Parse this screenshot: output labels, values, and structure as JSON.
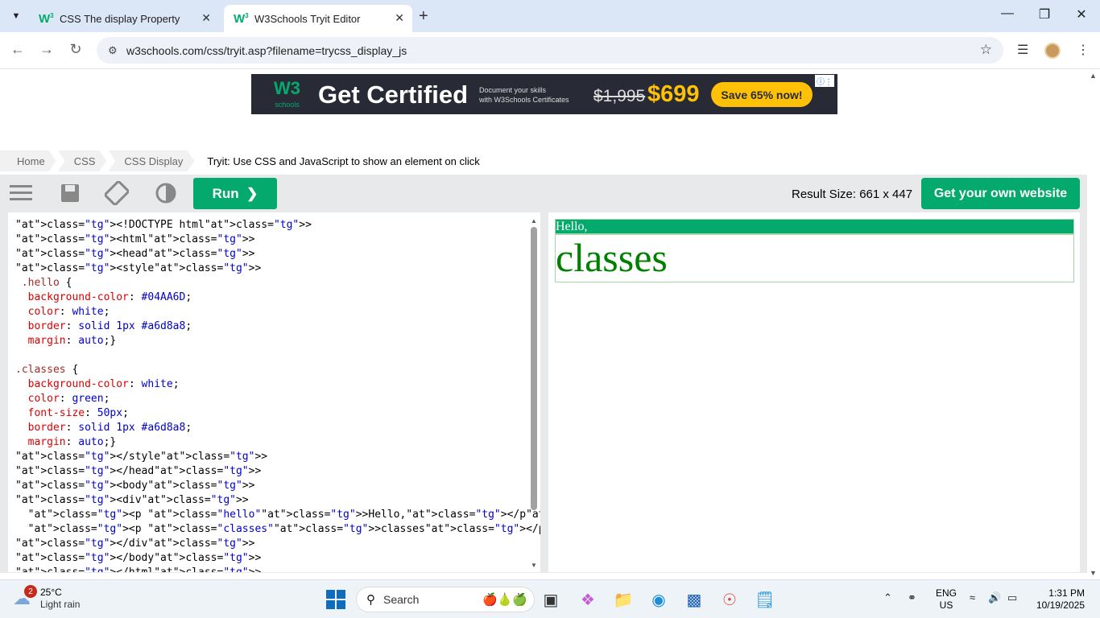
{
  "browser": {
    "tabs": [
      {
        "title": "CSS The display Property",
        "favicon": "W3"
      },
      {
        "title": "W3Schools Tryit Editor",
        "favicon": "W3"
      }
    ],
    "url": "w3schools.com/css/tryit.asp?filename=trycss_display_js"
  },
  "ad": {
    "brand_top": "W3",
    "brand_bottom": "schools",
    "headline": "Get Certified",
    "subtext_line1": "Document your skills",
    "subtext_line2": "with W3Schools Certificates",
    "old_price": "$1,995",
    "new_price": "$699",
    "cta": "Save 65% now!"
  },
  "breadcrumb": [
    "Home",
    "CSS",
    "CSS Display"
  ],
  "breadcrumb_current": "Tryit: Use CSS and JavaScript to show an element on click",
  "editor": {
    "run_label": "Run",
    "result_size": "Result Size: 661 x 447",
    "own_site_label": "Get your own website",
    "code_lines": [
      "<!DOCTYPE html>",
      "<html>",
      "<head>",
      "<style>",
      " .hello {",
      "  background-color: #04AA6D;",
      "  color: white;",
      "  border: solid 1px #a6d8a8;",
      "  margin: auto;}",
      "",
      ".classes {",
      "  background-color: white;",
      "  color: green;",
      "  font-size: 50px;",
      "  border: solid 1px #a6d8a8;",
      "  margin: auto;}",
      "</style>",
      "</head>",
      "<body>",
      "<div>",
      "  <p class=\"hello\">Hello,</p>",
      "  <p class=\"classes\">classes</p>",
      "</div>",
      "</body>",
      "</html>"
    ]
  },
  "result": {
    "hello_text": "Hello,",
    "classes_text": "classes"
  },
  "taskbar": {
    "weather_temp": "25°C",
    "weather_cond": "Light rain",
    "weather_badge": "2",
    "search_label": "Search",
    "lang_top": "ENG",
    "lang_bottom": "US",
    "time": "1:31 PM",
    "date": "10/19/2025"
  },
  "colors": {
    "accent_green": "#04AA6D",
    "ad_bg": "#282A35",
    "ad_yellow": "#FFC107"
  }
}
